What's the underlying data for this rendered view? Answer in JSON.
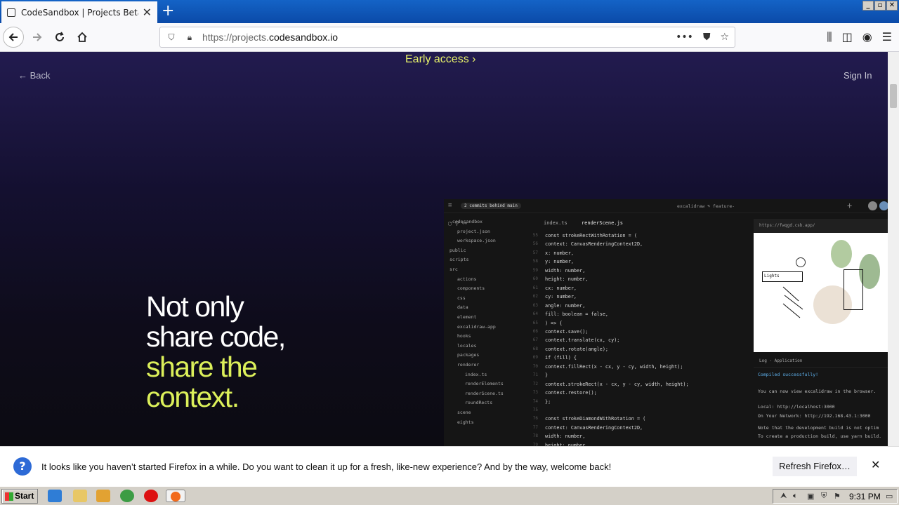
{
  "browser": {
    "tab_title": "CodeSandbox | Projects Beta - Dev",
    "tab_close": "✕",
    "new_tab": "+",
    "url_prefix": "https://projects.",
    "url_host": "codesandbox.io",
    "window_buttons": [
      "_",
      "▫",
      "✕"
    ]
  },
  "page": {
    "early_access": "Early access  ›",
    "back": "← Back",
    "sign_in": "Sign In",
    "headline_white_1": "Not only",
    "headline_white_2": "share code,",
    "headline_yellow_1": "share the",
    "headline_yellow_2": "context."
  },
  "editor": {
    "behind": "2 commits behind main",
    "branch": "excalidraw  ⌥  feature-",
    "tabs": [
      "index.ts",
      "renderScene.js"
    ],
    "files": [
      ".codesandbox",
      "project.json",
      "workspace.json",
      "public",
      "scripts",
      "src",
      "actions",
      "components",
      "css",
      "data",
      "element",
      "excalidraw-app",
      "hooks",
      "locales",
      "packages",
      "renderer",
      "index.ts",
      "renderElements",
      "renderScene.ts",
      "roundRects",
      "scene",
      "eights"
    ],
    "line_numbers": [
      "55",
      "56",
      "57",
      "58",
      "59",
      "60",
      "61",
      "62",
      "63",
      "64",
      "65",
      "66",
      "67",
      "68",
      "69",
      "70",
      "71",
      "72",
      "73",
      "74",
      "75",
      "76",
      "77",
      "78",
      "79"
    ],
    "code": [
      "const strokeRectWithRotation = (",
      "  context: CanvasRenderingContext2D,",
      "  x: number,",
      "  y: number,",
      "  width: number,",
      "  height: number,",
      "  cx: number,",
      "  cy: number,",
      "  angle: number,",
      "  fill: boolean = false,",
      ") => {",
      "  context.save();",
      "  context.translate(cx, cy);",
      "  context.rotate(angle);",
      "  if (fill) {",
      "    context.fillRect(x - cx, y - cy, width, height);",
      "  }",
      "  context.strokeRect(x - cx, y - cy, width, height);",
      "  context.restore();",
      "};",
      "",
      "const strokeDiamondWithRotation = (",
      "  context: CanvasRenderingContext2D,",
      "  width: number,",
      "  height: number,"
    ],
    "preview_url": "https://fwqgd.csb.app/",
    "preview_label": "Lights",
    "console_header": "Log · Application",
    "console_lines": [
      "Compiled successfully!",
      "You can now view excalidraw in the browser.",
      "  Local:            http://localhost:3000",
      "  On Your Network:  http://192.168.43.1:3000",
      "Note that the development build is not optim",
      "To create a production build, use yarn build."
    ]
  },
  "notification": {
    "message": "It looks like you haven’t started Firefox in a while. Do you want to clean it up for a fresh, like-new experience? And by the way, welcome back!",
    "button": "Refresh Firefox…",
    "close": "✕"
  },
  "taskbar": {
    "start": "Start",
    "time": "9:31 PM"
  },
  "colors": {
    "accent_yellow": "#dcf05a",
    "firefox_blue": "#0b4aa8",
    "page_bg": "#141030"
  }
}
